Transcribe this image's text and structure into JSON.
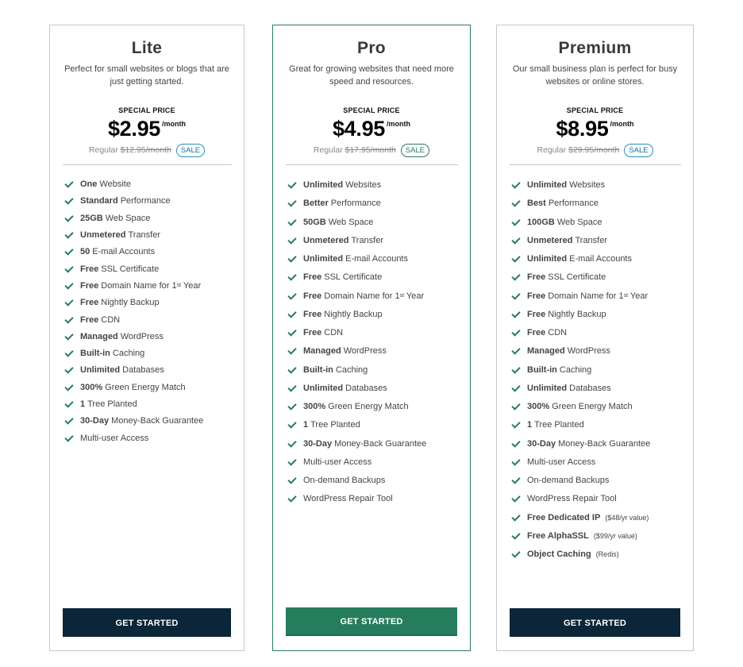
{
  "colors": {
    "accent_green": "#267d5e",
    "dark_navy": "#0b2638",
    "sale_blue": "#2a8fbf",
    "check_green": "#2a7a5e"
  },
  "plans": [
    {
      "name": "Lite",
      "description": "Perfect for small websites or blogs that are just getting started.",
      "special_label": "SPECIAL PRICE",
      "price": "$2.95",
      "period": "/month",
      "regular_label": "Regular",
      "regular_price": "$12.95/month",
      "sale_badge": "SALE",
      "features": [
        {
          "bold": "One",
          "text": "Website"
        },
        {
          "bold": "Standard",
          "text": "Performance"
        },
        {
          "bold": "25GB",
          "text": "Web Space"
        },
        {
          "bold": "Unmetered",
          "text": "Transfer"
        },
        {
          "bold": "50",
          "text": "E-mail Accounts"
        },
        {
          "bold": "Free",
          "text": "SSL Certificate"
        },
        {
          "bold": "Free",
          "text": "Domain Name for 1",
          "sup": "st",
          "after": " Year"
        },
        {
          "bold": "Free",
          "text": "Nightly Backup"
        },
        {
          "bold": "Free",
          "text": "CDN"
        },
        {
          "bold": "Managed",
          "text": "WordPress"
        },
        {
          "bold": "Built-in",
          "text": "Caching"
        },
        {
          "bold": "Unlimited",
          "text": "Databases"
        },
        {
          "bold": "300%",
          "text": "Green Energy Match"
        },
        {
          "bold": "1",
          "text": "Tree Planted"
        },
        {
          "bold": "30-Day",
          "text": "Money-Back Guarantee"
        },
        {
          "bold": "",
          "text": "Multi-user Access"
        }
      ],
      "button": "GET STARTED"
    },
    {
      "name": "Pro",
      "description": "Great for growing websites that need more speed and resources.",
      "special_label": "SPECIAL PRICE",
      "price": "$4.95",
      "period": "/month",
      "regular_label": "Regular",
      "regular_price": "$17.95/month",
      "sale_badge": "SALE",
      "features": [
        {
          "bold": "Unlimited",
          "text": "Websites"
        },
        {
          "bold": "Better",
          "text": "Performance"
        },
        {
          "bold": "50GB",
          "text": "Web Space"
        },
        {
          "bold": "Unmetered",
          "text": "Transfer"
        },
        {
          "bold": "Unlimited",
          "text": "E-mail Accounts"
        },
        {
          "bold": "Free",
          "text": "SSL Certificate"
        },
        {
          "bold": "Free",
          "text": "Domain Name for 1",
          "sup": "st",
          "after": " Year"
        },
        {
          "bold": "Free",
          "text": "Nightly Backup"
        },
        {
          "bold": "Free",
          "text": "CDN"
        },
        {
          "bold": "Managed",
          "text": "WordPress"
        },
        {
          "bold": "Built-in",
          "text": "Caching"
        },
        {
          "bold": "Unlimited",
          "text": "Databases"
        },
        {
          "bold": "300%",
          "text": "Green Energy Match"
        },
        {
          "bold": "1",
          "text": "Tree Planted"
        },
        {
          "bold": "30-Day",
          "text": "Money-Back Guarantee"
        },
        {
          "bold": "",
          "text": "Multi-user Access"
        },
        {
          "bold": "",
          "text": "On-demand Backups"
        },
        {
          "bold": "",
          "text": "WordPress Repair Tool"
        }
      ],
      "button": "GET STARTED"
    },
    {
      "name": "Premium",
      "description": "Our small business plan is perfect for busy websites or online stores.",
      "special_label": "SPECIAL PRICE",
      "price": "$8.95",
      "period": "/month",
      "regular_label": "Regular",
      "regular_price": "$29.95/month",
      "sale_badge": "SALE",
      "features": [
        {
          "bold": "Unlimited",
          "text": "Websites"
        },
        {
          "bold": "Best",
          "text": "Performance"
        },
        {
          "bold": "100GB",
          "text": "Web Space"
        },
        {
          "bold": "Unmetered",
          "text": "Transfer"
        },
        {
          "bold": "Unlimited",
          "text": "E-mail Accounts"
        },
        {
          "bold": "Free",
          "text": "SSL Certificate"
        },
        {
          "bold": "Free",
          "text": "Domain Name for 1",
          "sup": "st",
          "after": " Year"
        },
        {
          "bold": "Free",
          "text": "Nightly Backup"
        },
        {
          "bold": "Free",
          "text": "CDN"
        },
        {
          "bold": "Managed",
          "text": "WordPress"
        },
        {
          "bold": "Built-in",
          "text": "Caching"
        },
        {
          "bold": "Unlimited",
          "text": "Databases"
        },
        {
          "bold": "300%",
          "text": "Green Energy Match"
        },
        {
          "bold": "1",
          "text": "Tree Planted"
        },
        {
          "bold": "30-Day",
          "text": "Money-Back Guarantee"
        },
        {
          "bold": "",
          "text": "Multi-user Access"
        },
        {
          "bold": "",
          "text": "On-demand Backups"
        },
        {
          "bold": "",
          "text": "WordPress Repair Tool"
        },
        {
          "bold": "Free Dedicated IP",
          "text": "",
          "small": "($48/yr value)"
        },
        {
          "bold": "Free AlphaSSL",
          "text": "",
          "small": "($99/yr value)"
        },
        {
          "bold": "Object Caching",
          "text": "",
          "small": "(Redis)"
        }
      ],
      "button": "GET STARTED"
    }
  ]
}
